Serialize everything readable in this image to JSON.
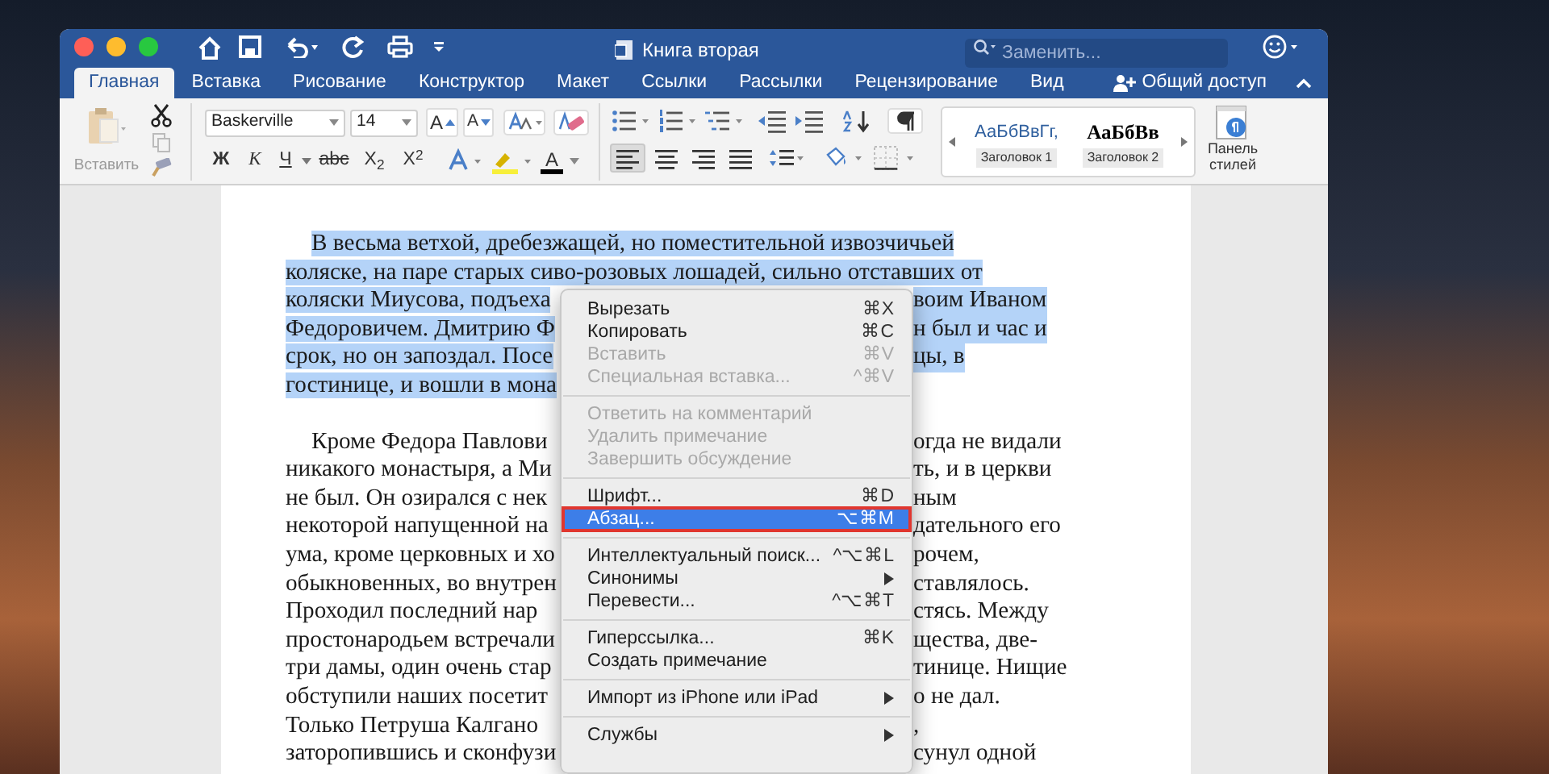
{
  "window": {
    "title": "Книга вторая",
    "search_placeholder": "Заменить..."
  },
  "tabs": [
    {
      "label": "Главная",
      "selected": true
    },
    {
      "label": "Вставка",
      "selected": false
    },
    {
      "label": "Рисование",
      "selected": false
    },
    {
      "label": "Конструктор",
      "selected": false
    },
    {
      "label": "Макет",
      "selected": false
    },
    {
      "label": "Ссылки",
      "selected": false
    },
    {
      "label": "Рассылки",
      "selected": false
    },
    {
      "label": "Рецензирование",
      "selected": false
    },
    {
      "label": "Вид",
      "selected": false
    }
  ],
  "share_button": "Общий доступ",
  "toolbar": {
    "paste_label": "Вставить",
    "font": "Baskerville",
    "size": "14",
    "grow_label": "A",
    "shrink_label": "A",
    "color_label": "A",
    "format_buttons": [
      "Ж",
      "К",
      "Ч",
      "abc",
      "X$_{2}$",
      "X$^{2}$"
    ],
    "styles": [
      {
        "sample": "АаБбВвГг,",
        "name": "Заголовок 1",
        "bold": false
      },
      {
        "sample": "АаБбВв",
        "name": "Заголовок 2",
        "bold": true
      }
    ],
    "styles_pane_label": "Панель стилей"
  },
  "document": {
    "paragraphs": [
      {
        "selected": true,
        "lines": [
          {
            "text": "В весьма ветхой, дребезжащей, но поместительной извозчичьей"
          },
          {
            "text": "коляске, на паре старых сиво-розовых лошадей, сильно отставших от"
          },
          {
            "left": "коляски Миусова, подъеха",
            "right": "воим Иваном"
          },
          {
            "left": "Федоровичем. Дмитрию Ф",
            "right": "н был и час и"
          },
          {
            "left": "срок, но он запоздал. Посе",
            "right": "цы, в"
          },
          {
            "left": "гостинице, и вошли в мона"
          }
        ]
      },
      {
        "selected": false,
        "lines": [
          {
            "left": "Кроме Федора Павлови",
            "right": "огда не видали"
          },
          {
            "left": "никакого монастыря, а Ми",
            "right": "ть, и в церкви"
          },
          {
            "left": "не был. Он озирался с нек",
            "right": "ным"
          },
          {
            "left": "некоторой напущенной на",
            "right": "дательного его"
          },
          {
            "left": "ума, кроме церковных и хо",
            "right": "рочем,"
          },
          {
            "left": "обыкновенных, во внутрен",
            "right": "ставлялось."
          },
          {
            "left": "Проходил последний нар",
            "right": "стясь. Между"
          },
          {
            "left": "простонародьем встречали",
            "right": "щества, две-"
          },
          {
            "left": "три дамы, один очень стар",
            "right": "тинице. Нищие"
          },
          {
            "left": "обступили наших посетит",
            "right": "о не дал."
          },
          {
            "left": "Только Петруша Калгано",
            "right": ","
          },
          {
            "left": "заторопившись и сконфузи",
            "right": "сунул одной"
          }
        ]
      }
    ]
  },
  "context_menu": {
    "items": [
      {
        "kind": "item",
        "label": "Вырезать",
        "shortcut": "⌘X",
        "disabled": false,
        "submenu": false,
        "selected": false
      },
      {
        "kind": "item",
        "label": "Копировать",
        "shortcut": "⌘C",
        "disabled": false,
        "submenu": false,
        "selected": false
      },
      {
        "kind": "item",
        "label": "Вставить",
        "shortcut": "⌘V",
        "disabled": true,
        "submenu": false,
        "selected": false
      },
      {
        "kind": "item",
        "label": "Специальная вставка...",
        "shortcut": "^⌘V",
        "disabled": true,
        "submenu": false,
        "selected": false
      },
      {
        "kind": "separator"
      },
      {
        "kind": "item",
        "label": "Ответить на комментарий",
        "disabled": true,
        "submenu": false,
        "selected": false
      },
      {
        "kind": "item",
        "label": "Удалить примечание",
        "disabled": true,
        "submenu": false,
        "selected": false
      },
      {
        "kind": "item",
        "label": "Завершить обсуждение",
        "disabled": true,
        "submenu": false,
        "selected": false
      },
      {
        "kind": "separator"
      },
      {
        "kind": "item",
        "label": "Шрифт...",
        "shortcut": "⌘D",
        "disabled": false,
        "submenu": false,
        "selected": false
      },
      {
        "kind": "item",
        "label": "Абзац...",
        "shortcut": "⌥⌘M",
        "disabled": false,
        "submenu": false,
        "selected": true
      },
      {
        "kind": "separator"
      },
      {
        "kind": "item",
        "label": "Интеллектуальный поиск...",
        "shortcut": "^⌥⌘L",
        "disabled": false,
        "submenu": false,
        "selected": false
      },
      {
        "kind": "item",
        "label": "Синонимы",
        "disabled": false,
        "submenu": true,
        "selected": false
      },
      {
        "kind": "item",
        "label": "Перевести...",
        "shortcut": "^⌥⌘T",
        "disabled": false,
        "submenu": false,
        "selected": false
      },
      {
        "kind": "separator"
      },
      {
        "kind": "item",
        "label": "Гиперссылка...",
        "shortcut": "⌘K",
        "disabled": false,
        "submenu": false,
        "selected": false
      },
      {
        "kind": "item",
        "label": "Создать примечание",
        "disabled": false,
        "submenu": false,
        "selected": false
      },
      {
        "kind": "separator"
      },
      {
        "kind": "item",
        "label": "Импорт из iPhone или iPad",
        "disabled": false,
        "submenu": true,
        "selected": false
      },
      {
        "kind": "separator"
      },
      {
        "kind": "item",
        "label": "Службы",
        "disabled": false,
        "submenu": true,
        "selected": false
      }
    ]
  }
}
